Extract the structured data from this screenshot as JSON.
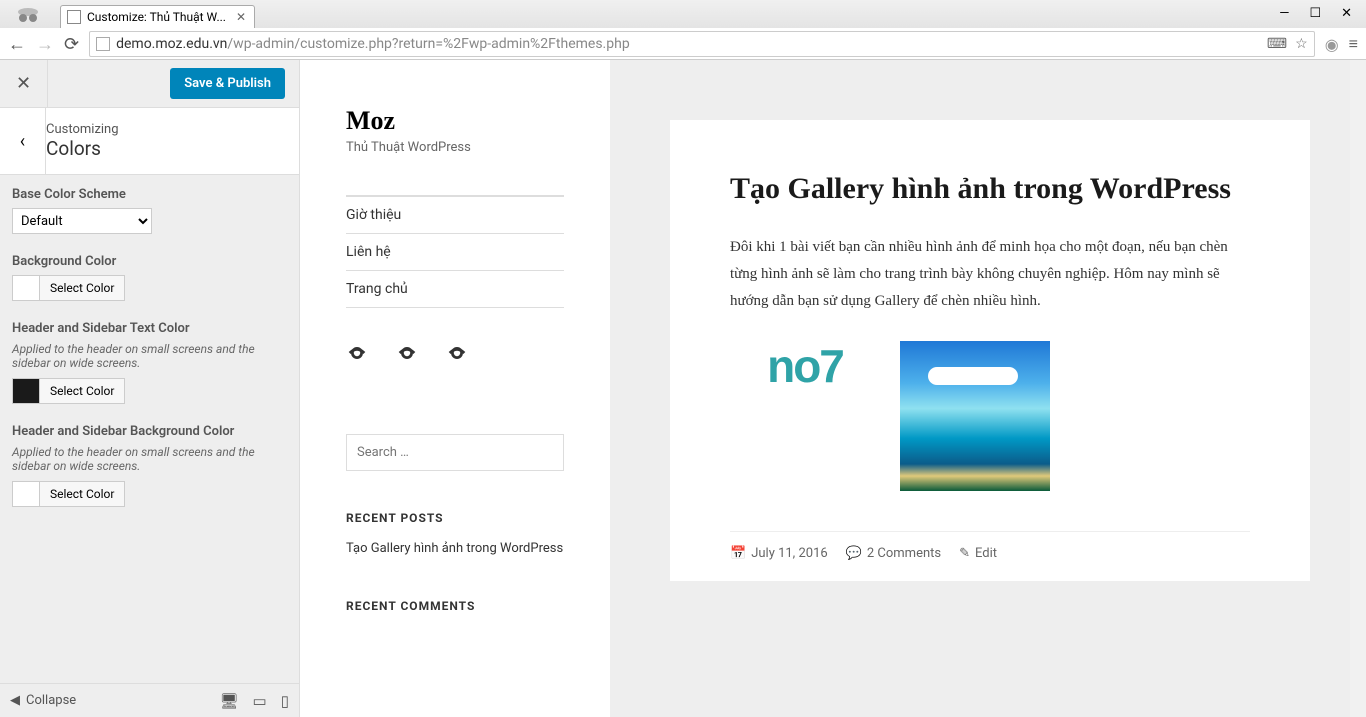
{
  "browser": {
    "tab_title": "Customize: Thủ Thuật W...",
    "url_host": "demo.moz.edu.vn",
    "url_path": "/wp-admin/customize.php?return=%2Fwp-admin%2Fthemes.php"
  },
  "panel": {
    "save_label": "Save & Publish",
    "customizing_label": "Customizing",
    "section_name": "Colors",
    "collapse_label": "Collapse",
    "controls": {
      "base_scheme": {
        "label": "Base Color Scheme",
        "value": "Default"
      },
      "bg_color": {
        "label": "Background Color",
        "button": "Select Color",
        "swatch": "#ffffff"
      },
      "header_text": {
        "label": "Header and Sidebar Text Color",
        "desc": "Applied to the header on small screens and the sidebar on wide screens.",
        "button": "Select Color",
        "swatch": "#1a1a1a"
      },
      "header_bg": {
        "label": "Header and Sidebar Background Color",
        "desc": "Applied to the header on small screens and the sidebar on wide screens.",
        "button": "Select Color",
        "swatch": "#ffffff"
      }
    }
  },
  "preview": {
    "site_title": "Moz",
    "site_desc": "Thủ Thuật WordPress",
    "menu": [
      "Giờ thiệu",
      "Liên hệ",
      "Trang chủ"
    ],
    "search_placeholder": "Search …",
    "recent_posts_label": "RECENT POSTS",
    "recent_post_1": "Tạo Gallery hình ảnh trong WordPress",
    "recent_comments_label": "RECENT COMMENTS",
    "post": {
      "title": "Tạo Gallery hình ảnh trong WordPress",
      "body": "Đôi khi 1 bài viết bạn cần nhiều hình ảnh để minh họa cho một đoạn, nếu bạn chèn từng hình ảnh sẽ làm cho trang trình bày không chuyên nghiệp. Hôm nay mình sẽ hướng dẫn bạn sử dụng Gallery để chèn nhiều hình.",
      "logo_text": "no7",
      "date": "July 11, 2016",
      "comments": "2 Comments",
      "edit": "Edit"
    }
  }
}
